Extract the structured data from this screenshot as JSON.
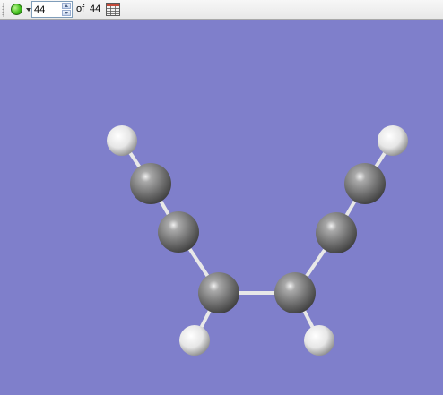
{
  "toolbar": {
    "frame_value": "44",
    "of_label": "of",
    "total_frames": "44",
    "ball_icon_color": "#45c21f"
  },
  "viewport": {
    "background": "#7f7fcb",
    "atoms": [
      {
        "element": "H",
        "color": "#f2f2f2"
      },
      {
        "element": "C",
        "color": "#8c8c8c"
      },
      {
        "element": "C",
        "color": "#8c8c8c"
      },
      {
        "element": "C",
        "color": "#8c8c8c"
      },
      {
        "element": "H",
        "color": "#f2f2f2"
      },
      {
        "element": "C",
        "color": "#8c8c8c"
      },
      {
        "element": "H",
        "color": "#f2f2f2"
      },
      {
        "element": "C",
        "color": "#8c8c8c"
      },
      {
        "element": "C",
        "color": "#8c8c8c"
      },
      {
        "element": "H",
        "color": "#f2f2f2"
      }
    ]
  }
}
